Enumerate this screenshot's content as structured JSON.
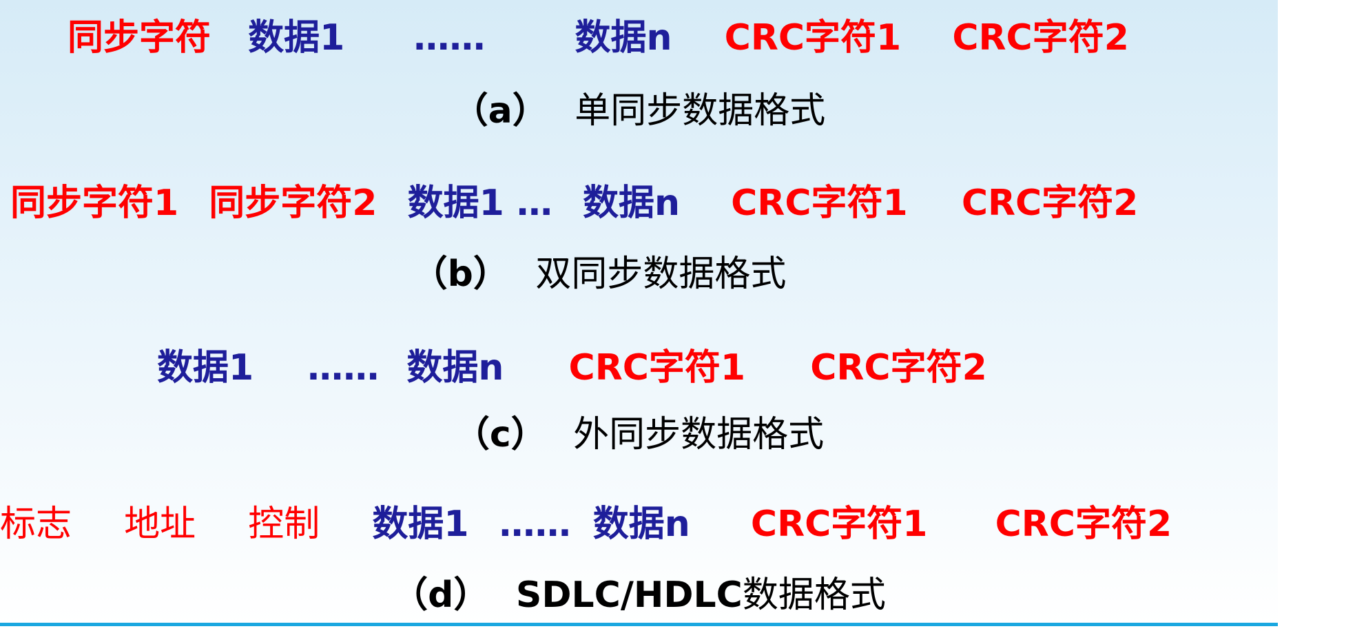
{
  "format_a": {
    "fields": [
      {
        "text": "同步字符",
        "color": "red"
      },
      {
        "text": "数据1",
        "color": "blue"
      },
      {
        "text": "……",
        "color": "blue"
      },
      {
        "text": "数据n",
        "color": "blue"
      },
      {
        "text": "CRC字符1",
        "color": "red"
      },
      {
        "text": "CRC字符2",
        "color": "red"
      }
    ],
    "caption_label": "（a）",
    "caption_title": "单同步数据格式"
  },
  "format_b": {
    "fields": [
      {
        "text": "同步字符1",
        "color": "red"
      },
      {
        "text": "同步字符2",
        "color": "red"
      },
      {
        "text": "数据1 …",
        "color": "blue"
      },
      {
        "text": "数据n",
        "color": "blue"
      },
      {
        "text": "CRC字符1",
        "color": "red"
      },
      {
        "text": "CRC字符2",
        "color": "red"
      }
    ],
    "caption_label": "（b）",
    "caption_title": "双同步数据格式"
  },
  "format_c": {
    "fields": [
      {
        "text": "数据1",
        "color": "blue"
      },
      {
        "text": "……",
        "color": "blue"
      },
      {
        "text": "数据n",
        "color": "blue"
      },
      {
        "text": "CRC字符1",
        "color": "red"
      },
      {
        "text": "CRC字符2",
        "color": "red"
      }
    ],
    "caption_label": "（c）",
    "caption_title": "外同步数据格式"
  },
  "format_d": {
    "fields": [
      {
        "text": "标志",
        "color": "red"
      },
      {
        "text": "地址",
        "color": "red"
      },
      {
        "text": "控制",
        "color": "red"
      },
      {
        "text": "数据1",
        "color": "blue"
      },
      {
        "text": "……",
        "color": "blue"
      },
      {
        "text": "数据n",
        "color": "blue"
      },
      {
        "text": "CRC字符1",
        "color": "red"
      },
      {
        "text": "CRC字符2",
        "color": "red"
      }
    ],
    "caption_label": "（d）",
    "caption_title_strong": "SDLC/HDLC",
    "caption_title": "数据格式"
  },
  "colors": {
    "sync_field": "#ff0000",
    "data_field": "#1e1e9a",
    "caption_text": "#000000",
    "bottom_rule": "#1aa7e0"
  }
}
